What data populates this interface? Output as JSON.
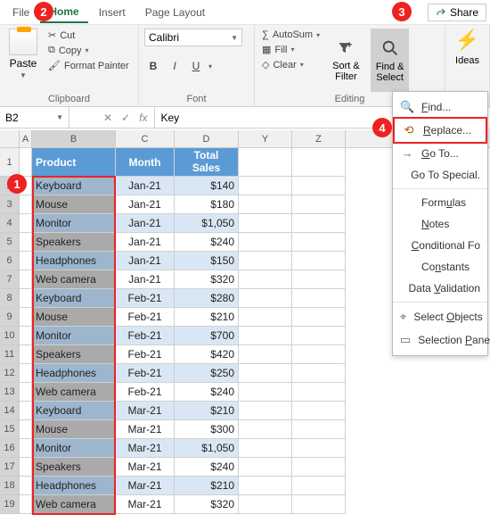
{
  "tabs": {
    "file": "File",
    "home": "Home",
    "insert": "Insert",
    "pageLayout": "Page Layout"
  },
  "share": "Share",
  "ribbon": {
    "clipboard": {
      "paste": "Paste",
      "cut": "Cut",
      "copy": "Copy",
      "formatPainter": "Format Painter",
      "label": "Clipboard"
    },
    "font": {
      "name": "Calibri",
      "bold": "B",
      "italic": "I",
      "underline": "U",
      "label": "Font"
    },
    "editing": {
      "autosum": "AutoSum",
      "fill": "Fill",
      "clear": "Clear",
      "sortFilter": "Sort &\nFilter",
      "findSelect": "Find &\nSelect",
      "label": "Editing"
    },
    "ideas": "Ideas"
  },
  "namebox": "B2",
  "formula": "Key",
  "headers": {
    "A": "A",
    "B": "B",
    "C": "C",
    "D": "D",
    "Y": "Y",
    "Z": "Z"
  },
  "tableHeaders": {
    "product": "Product",
    "month": "Month",
    "totalSales": "Total\nSales"
  },
  "rows": [
    {
      "n": "2",
      "p": "Keyboard",
      "m": "Jan-21",
      "s": "$140"
    },
    {
      "n": "3",
      "p": "Mouse",
      "m": "Jan-21",
      "s": "$180"
    },
    {
      "n": "4",
      "p": "Monitor",
      "m": "Jan-21",
      "s": "$1,050"
    },
    {
      "n": "5",
      "p": "Speakers",
      "m": "Jan-21",
      "s": "$240"
    },
    {
      "n": "6",
      "p": "Headphones",
      "m": "Jan-21",
      "s": "$150"
    },
    {
      "n": "7",
      "p": "Web camera",
      "m": "Jan-21",
      "s": "$320"
    },
    {
      "n": "8",
      "p": "Keyboard",
      "m": "Feb-21",
      "s": "$280"
    },
    {
      "n": "9",
      "p": "Mouse",
      "m": "Feb-21",
      "s": "$210"
    },
    {
      "n": "10",
      "p": "Monitor",
      "m": "Feb-21",
      "s": "$700"
    },
    {
      "n": "11",
      "p": "Speakers",
      "m": "Feb-21",
      "s": "$420"
    },
    {
      "n": "12",
      "p": "Headphones",
      "m": "Feb-21",
      "s": "$250"
    },
    {
      "n": "13",
      "p": "Web camera",
      "m": "Feb-21",
      "s": "$240"
    },
    {
      "n": "14",
      "p": "Keyboard",
      "m": "Mar-21",
      "s": "$210"
    },
    {
      "n": "15",
      "p": "Mouse",
      "m": "Mar-21",
      "s": "$300"
    },
    {
      "n": "16",
      "p": "Monitor",
      "m": "Mar-21",
      "s": "$1,050"
    },
    {
      "n": "17",
      "p": "Speakers",
      "m": "Mar-21",
      "s": "$240"
    },
    {
      "n": "18",
      "p": "Headphones",
      "m": "Mar-21",
      "s": "$210"
    },
    {
      "n": "19",
      "p": "Web camera",
      "m": "Mar-21",
      "s": "$320"
    }
  ],
  "menu": {
    "find": "Find...",
    "replace": "Replace...",
    "goto": "Go To...",
    "gotoSpecial": "Go To Special.",
    "formulas": "Formulas",
    "notes": "Notes",
    "conditional": "Conditional Fo",
    "constants": "Constants",
    "dataValidation": "Data Validation",
    "selectObjects": "Select Objects",
    "selectionPane": "Selection Pane"
  },
  "callouts": {
    "c1": "1",
    "c2": "2",
    "c3": "3",
    "c4": "4"
  }
}
